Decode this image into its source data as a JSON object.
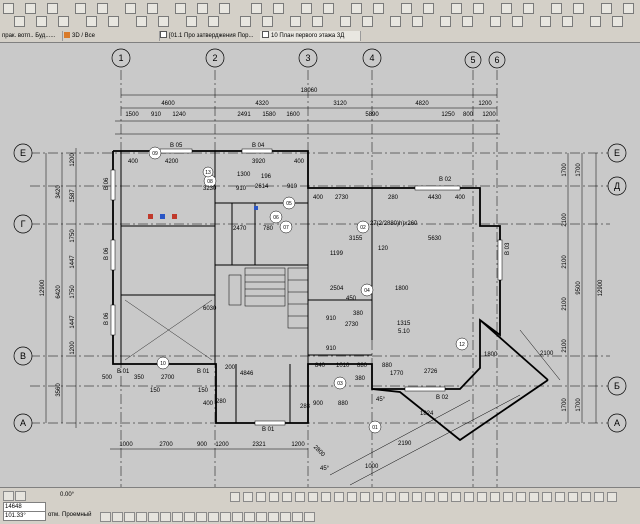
{
  "tabs": [
    {
      "label": "прак. вотп.. Буд......"
    },
    {
      "label": "3D / Все"
    },
    {
      "label": "[01.1 Про затверджения Пор..."
    },
    {
      "label": "10 План первого этажа 3Д"
    }
  ],
  "axes": {
    "vertical": [
      "1",
      "2",
      "3",
      "4",
      "5",
      "6"
    ],
    "horizontal": [
      "Е",
      "Д",
      "Г",
      "В",
      "Б",
      "А"
    ]
  },
  "dimensions": {
    "overall_top": "18060",
    "top_row": [
      "4600",
      "4320",
      "3120",
      "4820",
      "1200"
    ],
    "top_detail": [
      "1500",
      "910",
      "1240",
      "2491",
      "1580",
      "1600",
      "5890",
      "1250",
      "800",
      "1200"
    ],
    "bottom": [
      "1000",
      "2700",
      "900",
      "1200",
      "2321",
      "1200",
      "2800"
    ],
    "left_outer": "12900",
    "left_parts": [
      "3420",
      "6420",
      "3560"
    ],
    "left_detail": [
      "1200",
      "1587",
      "1750",
      "1447",
      "1750",
      "1447",
      "1200"
    ],
    "right_outer": "12900",
    "right_parts": [
      "1700",
      "5000",
      "9500",
      "1700"
    ],
    "right_detail": [
      "1700",
      "2100",
      "2100",
      "2100",
      "2100",
      "1700"
    ]
  },
  "interior_dims": [
    "400",
    "4200",
    "3920",
    "400",
    "4430",
    "400",
    "3230",
    "196",
    "910",
    "2614",
    "400",
    "2730",
    "280",
    "3155",
    "5630",
    "2470",
    "780",
    "6030",
    "4846",
    "2730",
    "380",
    "1315",
    "1800",
    "2504",
    "1199",
    "120",
    "840",
    "1010",
    "880",
    "880",
    "1770",
    "2726",
    "900",
    "880",
    "280",
    "150",
    "200",
    "500",
    "350",
    "2700",
    "150",
    "400",
    "283",
    "1824",
    "2100",
    "1800",
    "1000",
    "2190",
    "910",
    "450",
    "910",
    "910",
    "1300",
    "380",
    "5.10"
  ],
  "window_labels": [
    "В 05",
    "В 04",
    "В 02",
    "В 03",
    "В 06",
    "В 06",
    "В 06",
    "В 01",
    "В 01",
    "В 02",
    "В 01"
  ],
  "room_tags": [
    "09",
    "10",
    "05",
    "06",
    "07",
    "02",
    "03",
    "04",
    "01",
    "08",
    "12",
    "13"
  ],
  "stair_label": "27(2/2880)h)x260",
  "angles": [
    "45°",
    "45°"
  ],
  "status": {
    "angle": "0.00°",
    "coords": [
      "14648",
      "101.33°"
    ],
    "layer_label": "Проемный",
    "scale_label": "отм."
  },
  "colors": {
    "chrome": "#d4d0c8",
    "canvas": "#c9c9c9",
    "lines": "#000000",
    "accent_red": "#c0392b",
    "accent_blue": "#2a56c6"
  }
}
